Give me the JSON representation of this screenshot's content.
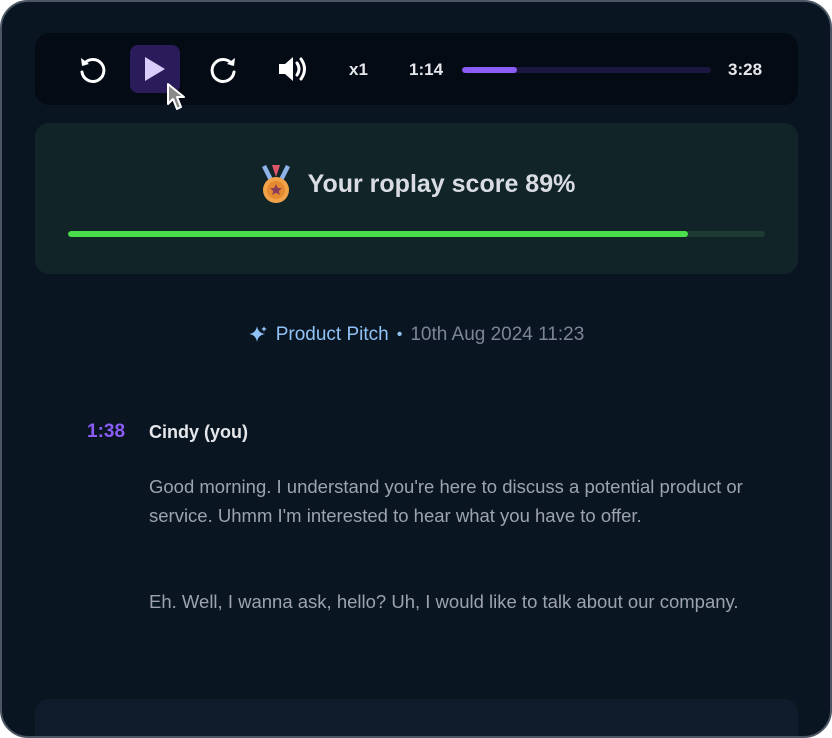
{
  "player": {
    "speed": "x1",
    "current_time": "1:14",
    "total_time": "3:28",
    "progress": 0.22,
    "icons": [
      "rewind-icon",
      "play-icon",
      "forward-icon",
      "volume-icon"
    ]
  },
  "score": {
    "title": "Your roplay score 89%",
    "percent": 0.89
  },
  "meta": {
    "topic": "Product Pitch",
    "date": "10th Aug 2024 11:23"
  },
  "transcript": {
    "timestamp": "1:38",
    "speaker": "Cindy (you)",
    "paragraphs": [
      "Good morning.  I understand you're here to discuss a potential product or service.  Uhmm I'm interested to hear what you have to offer.",
      "Eh. Well, I wanna ask, hello? Uh, I would like to talk about our company."
    ]
  },
  "colors": {
    "accent": "#8b5cf6",
    "score_fill": "#4ade4a",
    "topic": "#8fc2f5"
  }
}
